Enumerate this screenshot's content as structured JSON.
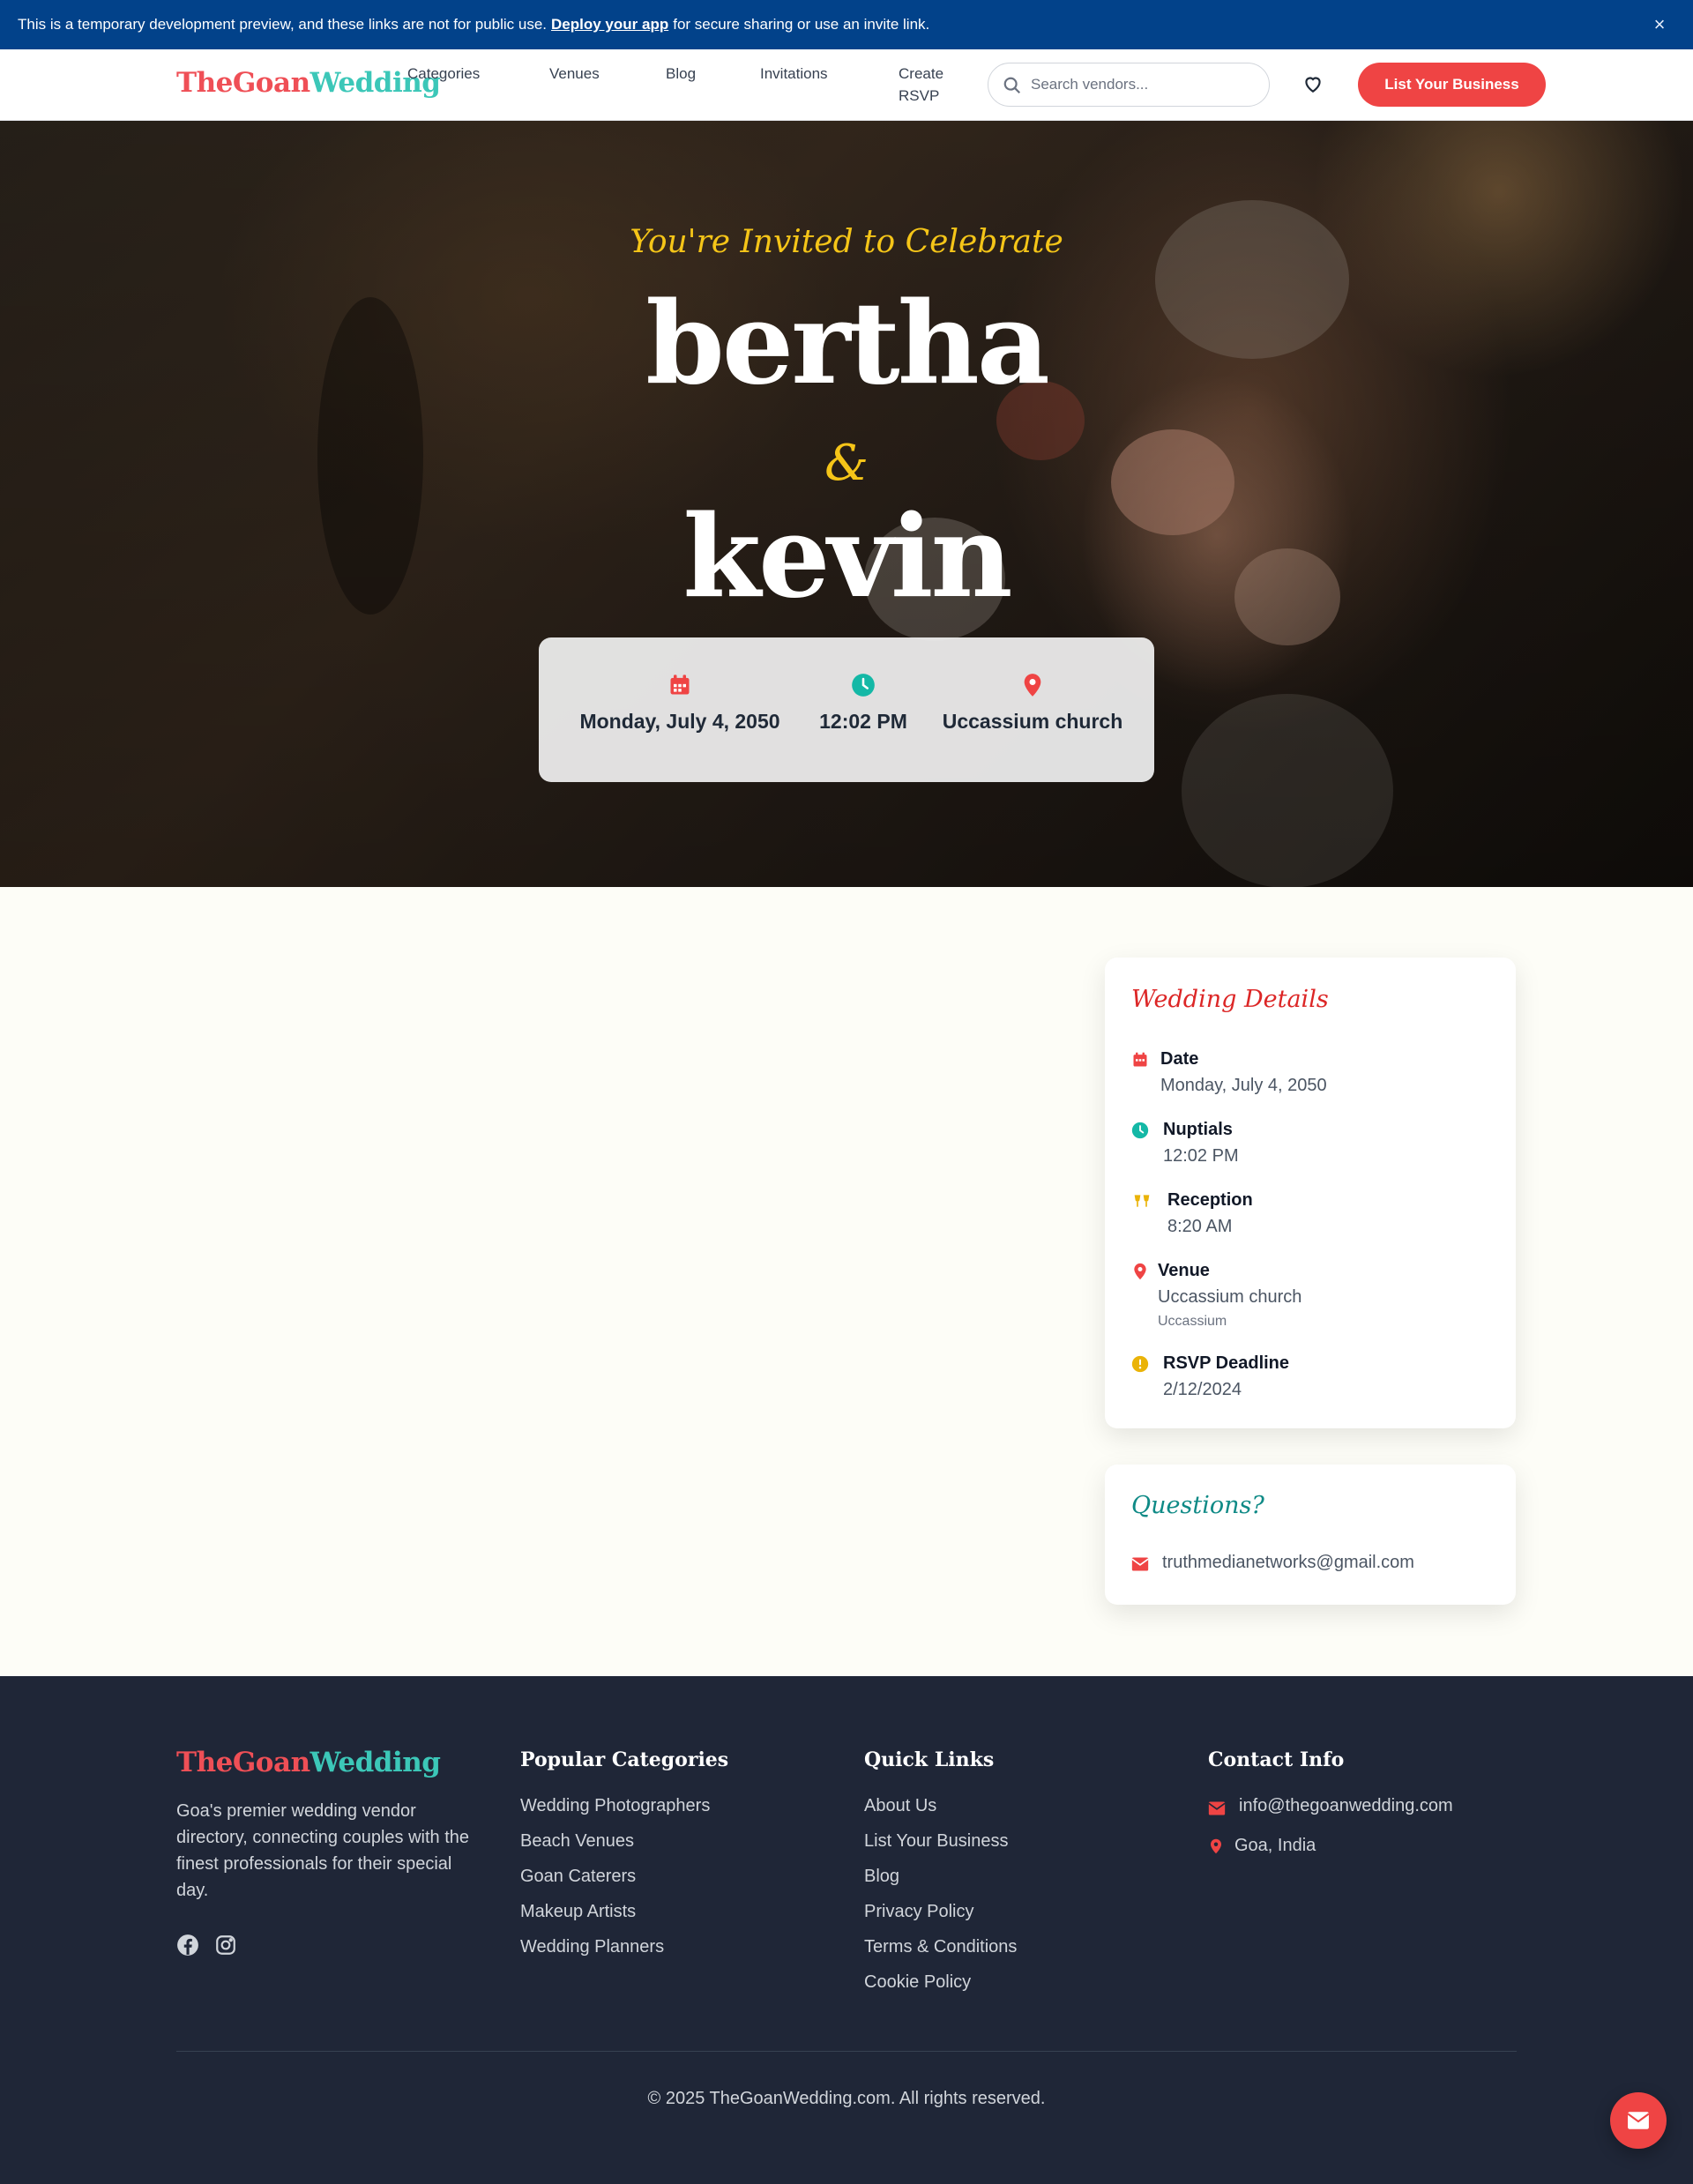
{
  "banner": {
    "text_before": "This is a temporary development preview, and these links are not for public use.",
    "link": "Deploy your app",
    "text_after": "for secure sharing or use an invite link.",
    "close_icon": "×"
  },
  "brand": {
    "part1": "TheGoan",
    "part2": "Wedding",
    "color1": "#ef4f56",
    "color2": "#3cc7b8"
  },
  "nav": {
    "links": [
      "Categories",
      "Venues",
      "Blog",
      "Invitations"
    ],
    "create_rsvp_line1": "Create",
    "create_rsvp_line2": "RSVP",
    "search_placeholder": "Search vendors...",
    "cta": "List Your Business",
    "accent": "#ef4444"
  },
  "hero": {
    "invite": "You're Invited to Celebrate",
    "name1": "bertha",
    "amp": "&",
    "name2": "kevin",
    "date": "Monday, July 4, 2050",
    "time": "12:02 PM",
    "venue": "Uccassium church"
  },
  "details": {
    "title": "Wedding Details",
    "date_label": "Date",
    "date_value": "Monday, July 4, 2050",
    "nuptials_label": "Nuptials",
    "nuptials_value": "12:02 PM",
    "reception_label": "Reception",
    "reception_value": "8:20 AM",
    "venue_label": "Venue",
    "venue_value": "Uccassium church",
    "venue_sub": "Uccassium",
    "rsvp_label": "RSVP Deadline",
    "rsvp_value": "2/12/2024"
  },
  "questions": {
    "title": "Questions?",
    "email": "truthmedianetworks@gmail.com"
  },
  "footer": {
    "description": "Goa's premier wedding vendor directory, connecting couples with the finest professionals for their special day.",
    "categories_title": "Popular Categories",
    "categories": [
      "Wedding Photographers",
      "Beach Venues",
      "Goan Caterers",
      "Makeup Artists",
      "Wedding Planners"
    ],
    "quick_title": "Quick Links",
    "quick_links": [
      "About Us",
      "List Your Business",
      "Blog",
      "Privacy Policy",
      "Terms & Conditions",
      "Cookie Policy"
    ],
    "contact_title": "Contact Info",
    "contact_email": "info@thegoanwedding.com",
    "contact_location": "Goa, India",
    "copyright": "© 2025 TheGoanWedding.com. All rights reserved."
  }
}
